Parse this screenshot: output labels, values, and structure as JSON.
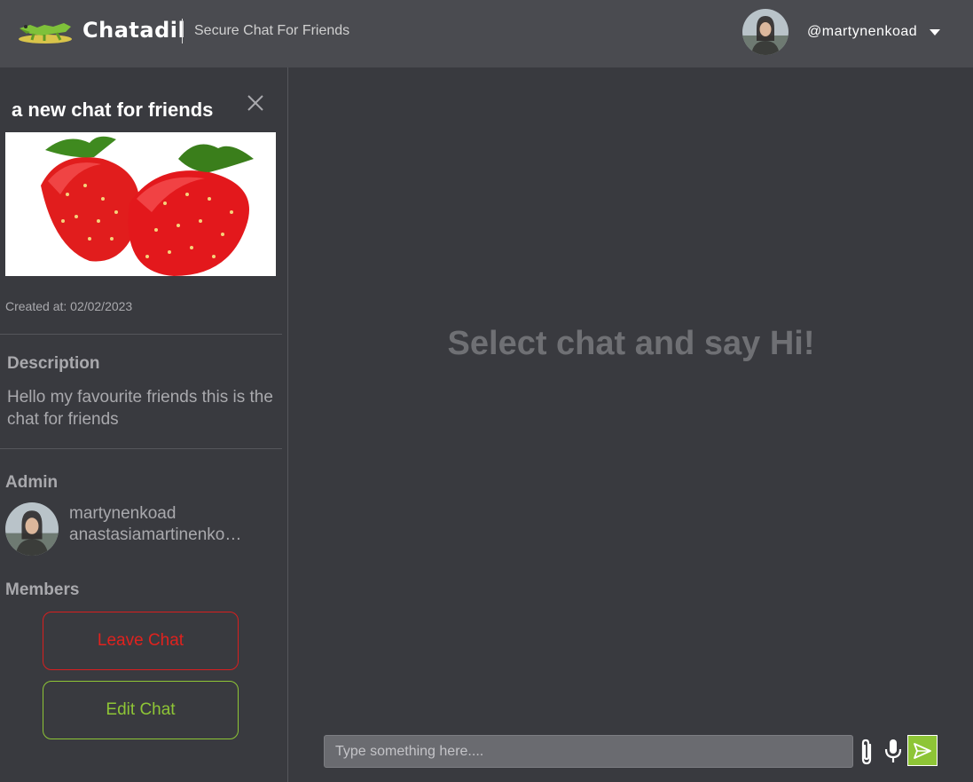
{
  "header": {
    "app_name": "Chatadil",
    "tagline": "Secure Chat For Friends",
    "username": "@martynenkoad"
  },
  "sidebar": {
    "chat_title": "a new chat for friends",
    "created_at": "Created at: 02/02/2023",
    "description_label": "Description",
    "description_text": "Hello my favourite friends this is the chat for friends",
    "admin_label": "Admin",
    "admin_name": "martynenkoad",
    "admin_email": "anastasiamartinenko@gmail.com",
    "members_label": "Members",
    "leave_button": "Leave Chat",
    "edit_button": "Edit Chat"
  },
  "main": {
    "empty_message": "Select chat and say Hi!",
    "input_placeholder": "Type something here....",
    "input_value": ""
  },
  "colors": {
    "accent_green": "#8ec536",
    "danger_red": "#e0221e",
    "header_bg": "#4a4b50",
    "body_bg": "#393a3f"
  },
  "icons": [
    "crocodile-logo-icon",
    "chevron-down-icon",
    "close-icon",
    "paperclip-icon",
    "microphone-icon",
    "send-icon"
  ]
}
